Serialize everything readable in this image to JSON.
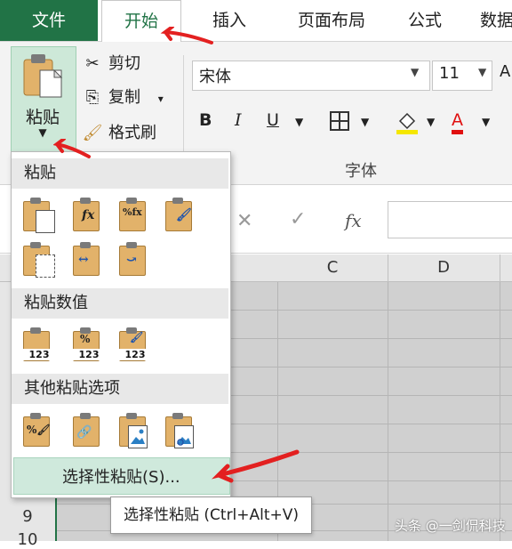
{
  "tabs": {
    "file": "文件",
    "home": "开始",
    "insert": "插入",
    "page_layout": "页面布局",
    "formulas": "公式",
    "data": "数据"
  },
  "clipboard": {
    "paste": "粘贴",
    "paste_arrow": "▼",
    "cut": "剪切",
    "copy": "复制",
    "copy_arrow": "▾",
    "format_painter": "格式刷"
  },
  "font": {
    "name": "宋体",
    "size": "11",
    "bold": "B",
    "italic": "I",
    "underline": "U",
    "group_label": "字体",
    "font_color": "A"
  },
  "formula_bar": {
    "cancel": "✕",
    "enter": "✓",
    "fx": "fx"
  },
  "columns": [
    "C",
    "D"
  ],
  "rows": [
    "9",
    "10"
  ],
  "paste_menu": {
    "section_paste": "粘贴",
    "section_values": "粘贴数值",
    "section_other": "其他粘贴选项",
    "paste_special": "选择性粘贴(S)...",
    "values_text": "123"
  },
  "tooltip": "选择性粘贴 (Ctrl+Alt+V)",
  "watermark": "头条 @一剑侃科技",
  "colors": {
    "excel_green": "#217346",
    "arrow_red": "#e32020",
    "highlight_yellow": "#f5e700",
    "font_red": "#e01010"
  }
}
